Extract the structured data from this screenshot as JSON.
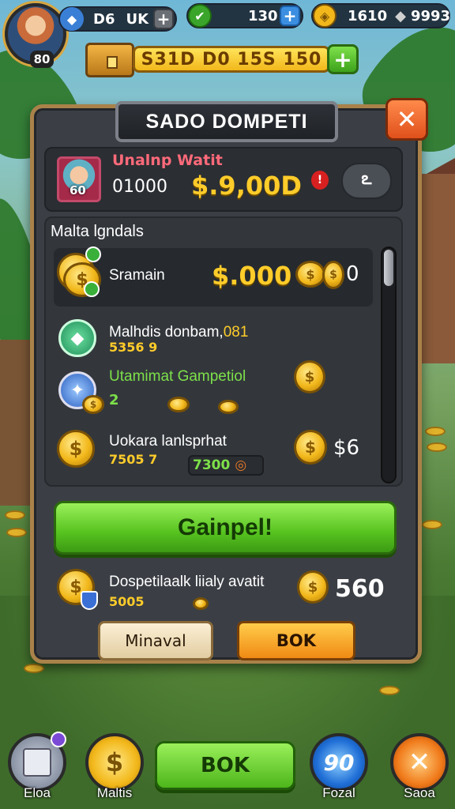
{
  "hud": {
    "avatar_level": "80",
    "gems_label": "D6",
    "gems_label2": "UK",
    "energy_value": "130",
    "coins_value": "1610",
    "silver_value": "9993",
    "gold_bar_value": "S31D D0 15S 150",
    "plus": "+"
  },
  "panel": {
    "title": "SADO DOMPETI",
    "close": "✕",
    "user": {
      "name": "Unalnp Watit",
      "level": "60",
      "id": "01000",
      "amount": "$.9,00D",
      "alert": "!",
      "swirl": "ఽ"
    },
    "section_label": "Malta lgndals",
    "rows": [
      {
        "title": "Sramain",
        "amount": "$.000",
        "num": "0"
      },
      {
        "title": "Malhdis donbam,",
        "title_accent": "081",
        "sub": "5356 9"
      },
      {
        "title": "Utamimat Gampetiol",
        "sub": "2"
      },
      {
        "title": "Uokara lanlsprhat",
        "sub": "7505 7",
        "pill": "7300",
        "num": "$6"
      }
    ],
    "primary_button": "Gainpel!",
    "bottom_row": {
      "title": "Dospetilaalk liialy avatit",
      "sub": "5005",
      "num": "560"
    },
    "button_left": "Minaval",
    "button_right": "BOK"
  },
  "nav": {
    "items": [
      {
        "label": "Eloa"
      },
      {
        "label": "Maltis"
      },
      {
        "label": "Fozal",
        "badge": "90"
      },
      {
        "label": "Saoa"
      }
    ],
    "center_button": "BOK"
  },
  "colors": {
    "accent_gold": "#ffcc2a",
    "accent_green": "#56c21f",
    "panel_bg": "#3b3f45",
    "close_orange": "#e0501b"
  },
  "icons": [
    "shield-gem-icon",
    "energy-leaf-icon",
    "gold-coin-icon",
    "silver-ore-icon",
    "treasure-chest-icon",
    "coin-stack-icon",
    "close-icon"
  ]
}
